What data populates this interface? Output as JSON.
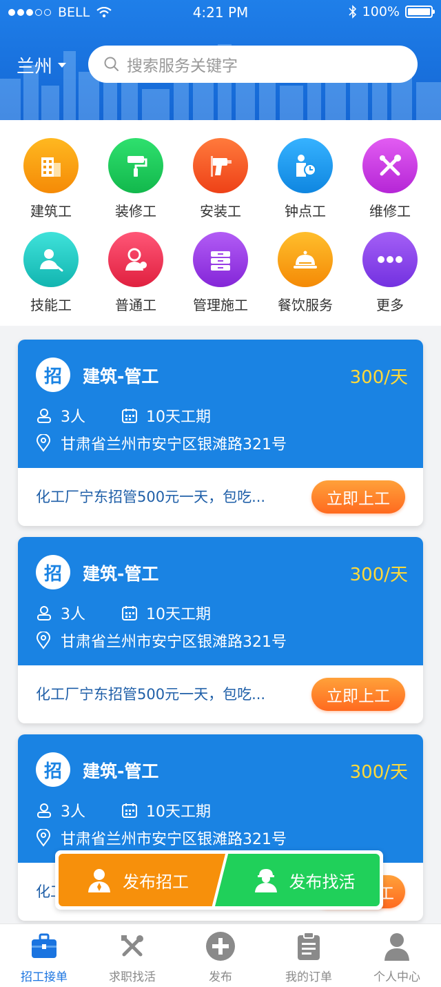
{
  "status_bar": {
    "carrier": "BELL",
    "time": "4:21 PM",
    "battery": "100%"
  },
  "header": {
    "city": "兰州",
    "search_placeholder": "搜索服务关键字"
  },
  "categories": [
    {
      "label": "建筑工",
      "color": "#f59a0c",
      "icon": "building-icon"
    },
    {
      "label": "装修工",
      "color": "#1fce5c",
      "icon": "paint-roller-icon"
    },
    {
      "label": "安装工",
      "color": "#f8562a",
      "icon": "drill-icon"
    },
    {
      "label": "钟点工",
      "color": "#1a97ec",
      "icon": "hourly-worker-icon"
    },
    {
      "label": "维修工",
      "color": "#d13be5",
      "icon": "repair-tools-icon"
    },
    {
      "label": "技能工",
      "color": "#20cdc8",
      "icon": "skilled-worker-icon"
    },
    {
      "label": "普通工",
      "color": "#f43358",
      "icon": "general-worker-icon"
    },
    {
      "label": "管理施工",
      "color": "#9d3ee6",
      "icon": "cabinet-icon"
    },
    {
      "label": "餐饮服务",
      "color": "#f7a10e",
      "icon": "food-cloche-icon"
    },
    {
      "label": "更多",
      "color": "#8b45ea",
      "icon": "more-icon"
    }
  ],
  "jobs": [
    {
      "badge": "招",
      "title": "建筑-管工",
      "price": "300/天",
      "people": "3人",
      "duration": "10天工期",
      "address": "甘肃省兰州市安宁区银滩路321号",
      "desc": "化工厂宁东招管500元一天，包吃...",
      "action": "立即上工"
    },
    {
      "badge": "招",
      "title": "建筑-管工",
      "price": "300/天",
      "people": "3人",
      "duration": "10天工期",
      "address": "甘肃省兰州市安宁区银滩路321号",
      "desc": "化工厂宁东招管500元一天，包吃...",
      "action": "立即上工"
    },
    {
      "badge": "招",
      "title": "建筑-管工",
      "price": "300/天",
      "people": "3人",
      "duration": "10天工期",
      "address": "甘肃省兰州市安宁区银滩路321号",
      "desc": "化工",
      "action": "工"
    }
  ],
  "floating_actions": {
    "post_job": "发布招工",
    "find_work": "发布找活"
  },
  "tabs": [
    {
      "label": "招工接单",
      "icon": "briefcase-icon",
      "active": true
    },
    {
      "label": "求职找活",
      "icon": "tools-icon",
      "active": false
    },
    {
      "label": "发布",
      "icon": "plus-circle-icon",
      "active": false
    },
    {
      "label": "我的订单",
      "icon": "clipboard-icon",
      "active": false
    },
    {
      "label": "个人中心",
      "icon": "user-icon",
      "active": false
    }
  ]
}
